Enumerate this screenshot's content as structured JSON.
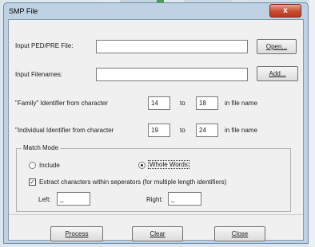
{
  "window": {
    "title": "SMP File",
    "close_glyph": "x"
  },
  "fields": {
    "ped_file_label": "Input PED/PRE File:",
    "ped_file_value": "",
    "open_button": "Open...",
    "filenames_label": "Input Filenames:",
    "filenames_value": "",
    "add_button": "Add...",
    "family_label": "\"Family\" Identifier from character",
    "family_from": "14",
    "family_to_word": "to",
    "family_to": "18",
    "family_suffix": "in file name",
    "individual_label": "\"Individual Identifier from character",
    "individual_from": "19",
    "individual_to_word": "to",
    "individual_to": "24",
    "individual_suffix": "in file name"
  },
  "match_mode": {
    "legend": "Match Mode",
    "include_label": "Include",
    "whole_words_label": "Whole Words",
    "selected": "Whole Words",
    "extract_label": "Extract characters within seperators (for  multiple length  identifiers)",
    "extract_checked": true,
    "left_label": "Left:",
    "left_value": "_",
    "right_label": "Right:",
    "right_value": "_"
  },
  "buttons": {
    "process": "Process",
    "clear": "Clear",
    "close": "Close"
  },
  "icons": {
    "close": "close-icon",
    "radio": "radio-icon",
    "checkbox": "checkbox-icon"
  }
}
